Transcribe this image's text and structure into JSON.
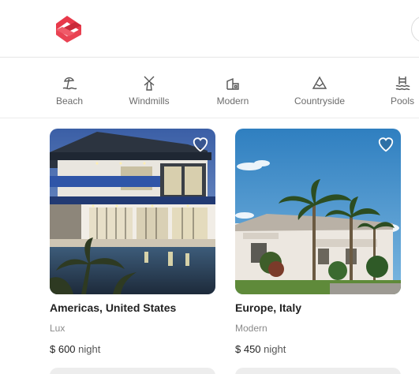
{
  "colors": {
    "brand": "#e8394a",
    "accent_text": "#222222",
    "muted": "#8a8a8a"
  },
  "categories": [
    {
      "label": "Beach",
      "icon": "beach-umbrella-icon"
    },
    {
      "label": "Windmills",
      "icon": "windmill-icon"
    },
    {
      "label": "Modern",
      "icon": "modern-house-icon"
    },
    {
      "label": "Countryside",
      "icon": "mountain-icon"
    },
    {
      "label": "Pools",
      "icon": "pool-ladder-icon"
    }
  ],
  "listings": [
    {
      "location": "Americas, United States",
      "type": "Lux",
      "price": "$ 600",
      "unit": "night"
    },
    {
      "location": "Europe, Italy",
      "type": "Modern",
      "price": "$ 450",
      "unit": "night"
    }
  ]
}
